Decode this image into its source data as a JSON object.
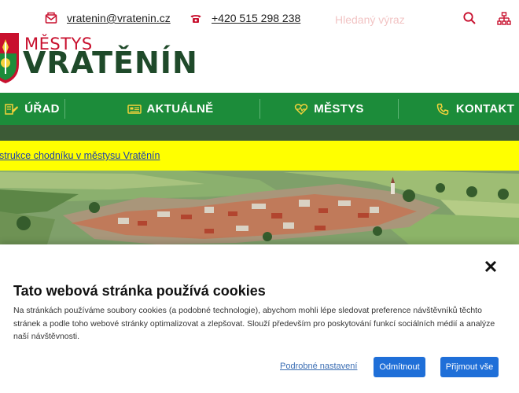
{
  "topbar": {
    "email": "vratenin@vratenin.cz",
    "phone": "+420 515 298 238",
    "search_placeholder": "Hledaný výraz"
  },
  "logo": {
    "small": "MĚSTYS",
    "big": "VRATĚNÍN"
  },
  "nav": {
    "items": [
      {
        "label": "ÚŘAD",
        "icon": "office-icon"
      },
      {
        "label": "AKTUÁLNĚ",
        "icon": "newspaper-icon"
      },
      {
        "label": "MĚSTYS",
        "icon": "heart-pulse-icon"
      },
      {
        "label": "KONTAKT",
        "icon": "phone-icon"
      }
    ]
  },
  "alert": {
    "link": "nstrukce chodníku v městysu Vratěnín"
  },
  "cookie": {
    "title": "Tato webová stránka používá cookies",
    "text": "Na stránkách používáme soubory cookies (a podobné technologie), abychom mohli lépe sledovat preference návštěvníků těchto stránek a podle toho webové stránky optimalizovat a zlepšovat. Slouží především pro poskytování funkcí sociálních médií a analýze naší návštěvnosti.",
    "settings_label": "Podrobné nastavení",
    "reject_label": "Odmítnout",
    "accept_label": "Přijmout vše"
  },
  "colors": {
    "brand_green": "#1c8c3a",
    "brand_red": "#c8102e",
    "logo_dark_green": "#1f4a2a",
    "alert_yellow": "#ffff00",
    "button_blue": "#1f6fd8"
  }
}
